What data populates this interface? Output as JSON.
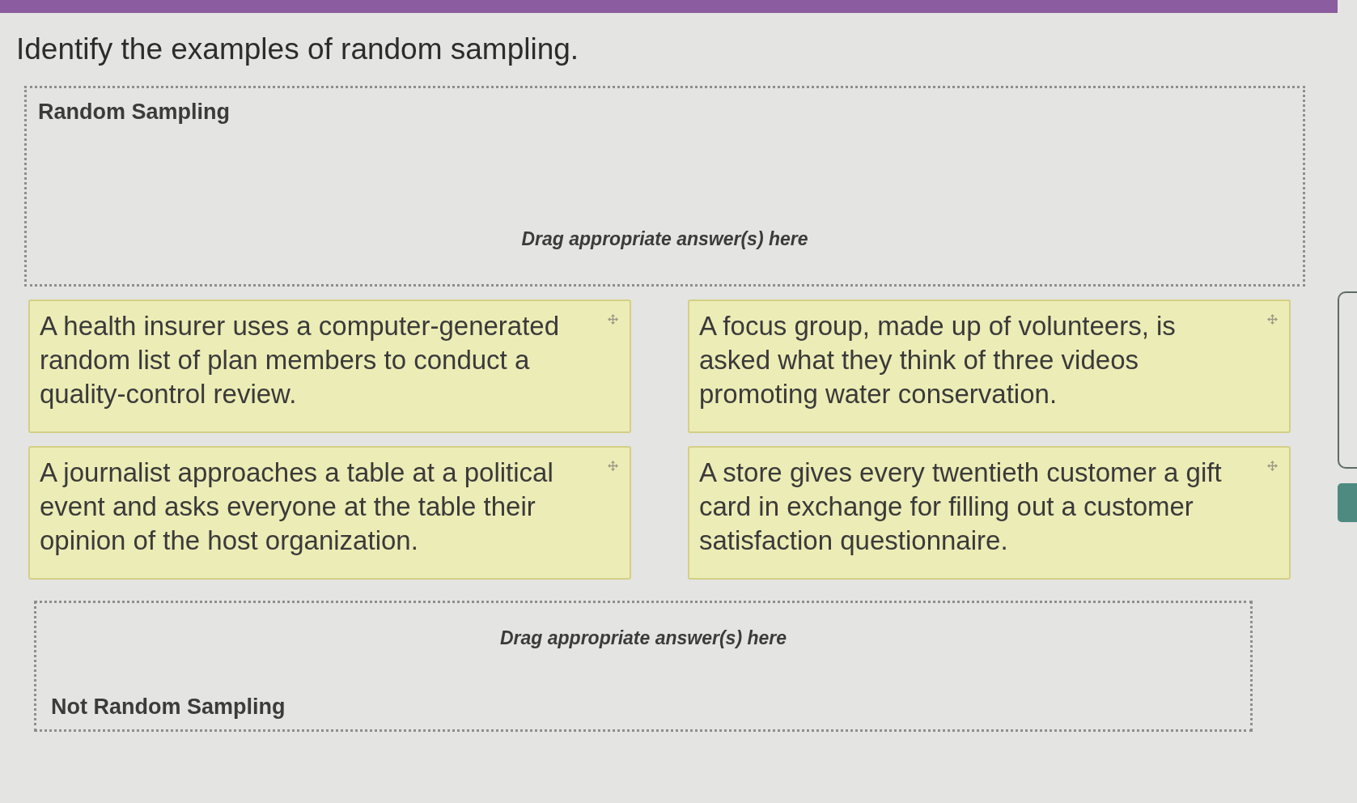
{
  "question": "Identify the examples of random sampling.",
  "top_drop_zone": {
    "label": "Random Sampling",
    "placeholder": "Drag appropriate answer(s) here"
  },
  "answer_cards": [
    {
      "text": "A health insurer uses a computer-generated random list of plan members to conduct a quality-control review."
    },
    {
      "text": "A focus group, made up of volunteers, is asked what they think of three videos promoting water conservation."
    },
    {
      "text": "A journalist approaches a table at a political event and asks everyone at the table their opinion of the host organization."
    },
    {
      "text": "A store gives every twentieth customer a gift card in exchange for filling out a customer satisfaction questionnaire."
    }
  ],
  "bottom_drop_zone": {
    "label": "Not Random Sampling",
    "placeholder": "Drag appropriate answer(s) here"
  }
}
